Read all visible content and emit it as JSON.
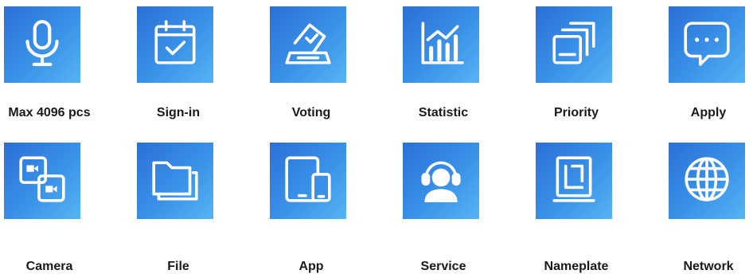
{
  "features": [
    {
      "label": "Max 4096 pcs",
      "icon": "microphone-icon"
    },
    {
      "label": "Sign-in",
      "icon": "calendar-check-icon"
    },
    {
      "label": "Voting",
      "icon": "ballot-box-icon"
    },
    {
      "label": "Statistic",
      "icon": "bar-chart-icon"
    },
    {
      "label": "Priority",
      "icon": "stacked-windows-icon"
    },
    {
      "label": "Apply",
      "icon": "chat-bubble-icon"
    },
    {
      "label": "Camera",
      "icon": "dual-camera-icon"
    },
    {
      "label": "File",
      "icon": "folder-icon"
    },
    {
      "label": "App",
      "icon": "tablet-phone-icon"
    },
    {
      "label": "Service",
      "icon": "headset-user-icon"
    },
    {
      "label": "Nameplate",
      "icon": "nameplate-icon"
    },
    {
      "label": "Network",
      "icon": "globe-icon"
    }
  ],
  "colors": {
    "tile_start": "#2b6fd6",
    "tile_end": "#55b4f4",
    "icon_stroke": "#ffffff",
    "label_text": "#1a1a1a"
  }
}
